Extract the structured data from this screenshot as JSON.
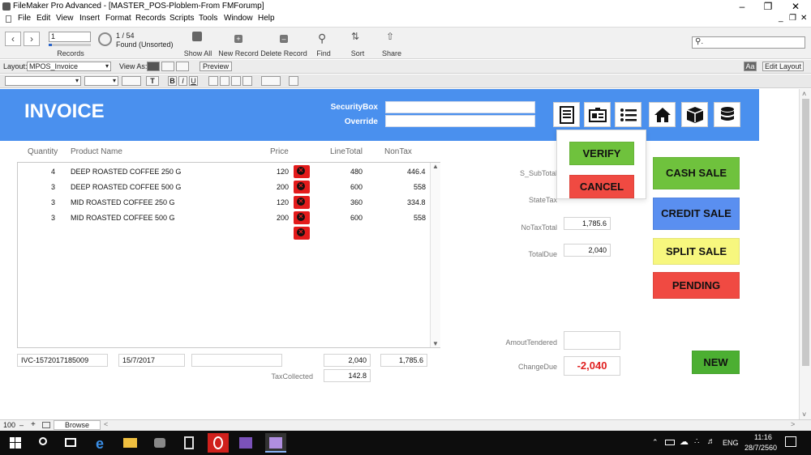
{
  "window": {
    "title": "FileMaker Pro Advanced - [MASTER_POS-Ploblem-From FMForump]"
  },
  "menu": [
    "File",
    "Edit",
    "View",
    "Insert",
    "Format",
    "Records",
    "Scripts",
    "Tools",
    "Window",
    "Help"
  ],
  "toolbar": {
    "record_current": "1",
    "record_total": "1 / 54",
    "found_status": "Found (Unsorted)",
    "records_label": "Records",
    "show_all": "Show All",
    "new_record": "New Record",
    "delete_record": "Delete Record",
    "find": "Find",
    "sort": "Sort",
    "share": "Share"
  },
  "layoutbar": {
    "layout_label": "Layout:",
    "layout_value": "MPOS_Invoice",
    "view_as_label": "View As:",
    "preview": "Preview",
    "edit_layout": "Edit Layout",
    "aa": "Aa"
  },
  "invoice": {
    "title": "INVOICE",
    "security_label": "SecurityBox",
    "override_label": "Override",
    "columns": {
      "quantity": "Quantity",
      "product": "Product Name",
      "price": "Price",
      "linetotal": "LineTotal",
      "nontax": "NonTax"
    },
    "items": [
      {
        "qty": "4",
        "name": "DEEP ROASTED COFFEE 250 G",
        "price": "120",
        "line": "480",
        "nontax": "446.4"
      },
      {
        "qty": "3",
        "name": "DEEP ROASTED COFFEE 500 G",
        "price": "200",
        "line": "600",
        "nontax": "558"
      },
      {
        "qty": "3",
        "name": "MID ROASTED COFFEE 250 G",
        "price": "120",
        "line": "360",
        "nontax": "334.8"
      },
      {
        "qty": "3",
        "name": "MID ROASTED COFFEE 500 G",
        "price": "200",
        "line": "600",
        "nontax": "558"
      }
    ],
    "invoice_id": "IVC-1572017185009",
    "date": "15/7/2017",
    "total_line": "2,040",
    "total_nontax": "1,785.6",
    "tax_label": "TaxCollected",
    "tax_value": "142.8"
  },
  "summary": {
    "subtotal_label": "S_SubTotal",
    "statetax_label": "StateTax",
    "notax_label": "NoTaxTotal",
    "notax_value": "1,785.6",
    "totaldue_label": "TotalDue",
    "totaldue_value": "2,040",
    "tendered_label": "AmoutTendered",
    "changedue_label": "ChangeDue",
    "changedue_value": "-2,040"
  },
  "popover": {
    "verify": "VERIFY",
    "cancel": "CANCEL"
  },
  "actions": {
    "cash": "CASH SALE",
    "credit": "CREDIT SALE",
    "split": "SPLIT SALE",
    "pending": "PENDING",
    "new": "NEW"
  },
  "statusbar": {
    "zoom": "100",
    "mode": "Browse"
  },
  "taskbar": {
    "lang": "ENG",
    "time": "11:16",
    "date": "28/7/2560"
  },
  "colors": {
    "header_blue": "#4a90ee",
    "verify_green": "#6fc23d",
    "cancel_red": "#f04a42",
    "cash_green": "#6fc23d",
    "credit_blue": "#5a8ff0",
    "split_yellow": "#f7f77e",
    "pending_red": "#f04a42",
    "new_green": "#4caf32",
    "change_red": "#e02020"
  }
}
